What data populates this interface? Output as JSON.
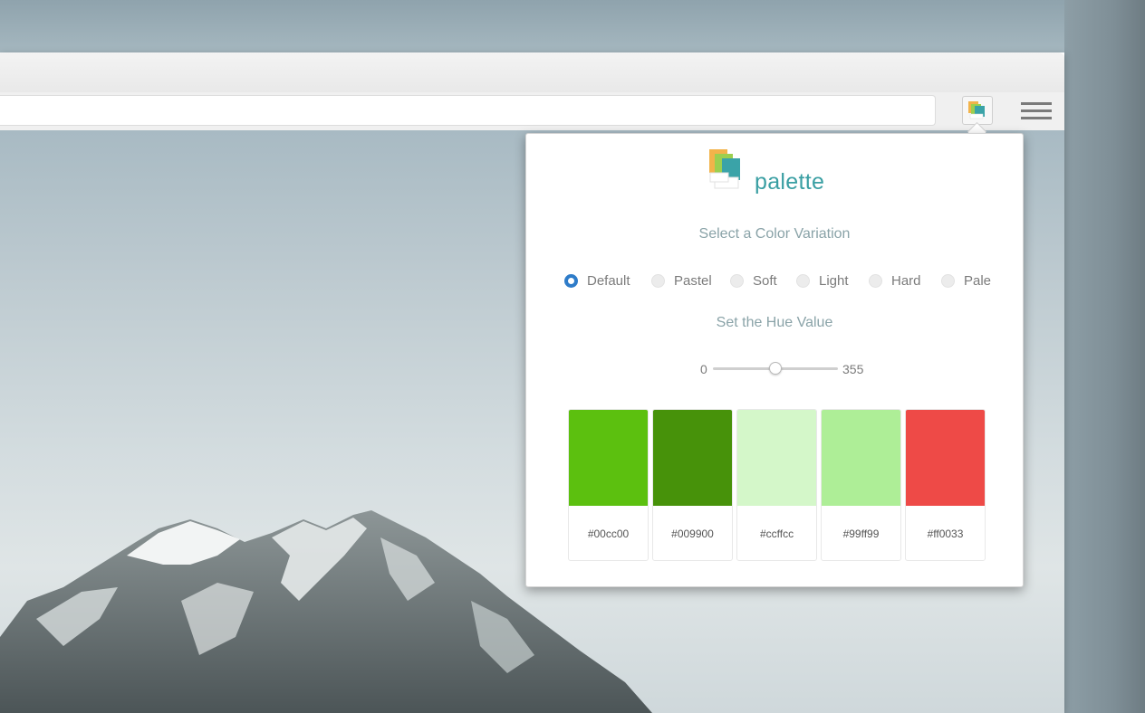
{
  "extension": {
    "name": "palette",
    "icon": "palette-icon",
    "toolbar_icon": "palette-extension-icon",
    "menu_icon": "hamburger-menu-icon"
  },
  "popup": {
    "variation_title": "Select a Color Variation",
    "variations": [
      {
        "label": "Default",
        "selected": true
      },
      {
        "label": "Pastel",
        "selected": false
      },
      {
        "label": "Soft",
        "selected": false
      },
      {
        "label": "Light",
        "selected": false
      },
      {
        "label": "Hard",
        "selected": false
      },
      {
        "label": "Pale",
        "selected": false
      }
    ],
    "hue_title": "Set the Hue Value",
    "hue": {
      "min": "0",
      "max": "355",
      "value_fraction": 0.5
    },
    "swatches": [
      {
        "hex": "#00cc00",
        "color": "#5cc00f"
      },
      {
        "hex": "#009900",
        "color": "#47920a"
      },
      {
        "hex": "#ccffcc",
        "color": "#d4f7c9"
      },
      {
        "hex": "#99ff99",
        "color": "#aeee97"
      },
      {
        "hex": "#ff0033",
        "color": "#ee4a47"
      }
    ]
  },
  "colors": {
    "accent": "#3a9fa3",
    "radio_selected": "#2e7cc9"
  }
}
